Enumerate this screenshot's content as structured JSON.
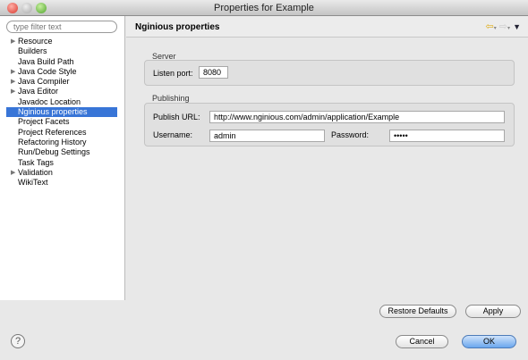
{
  "window": {
    "title": "Properties for Example"
  },
  "sidebar": {
    "filter_placeholder": "type filter text",
    "items": [
      {
        "label": "Resource",
        "expandable": true
      },
      {
        "label": "Builders"
      },
      {
        "label": "Java Build Path"
      },
      {
        "label": "Java Code Style",
        "expandable": true
      },
      {
        "label": "Java Compiler",
        "expandable": true
      },
      {
        "label": "Java Editor",
        "expandable": true
      },
      {
        "label": "Javadoc Location"
      },
      {
        "label": "Nginious properties",
        "selected": true
      },
      {
        "label": "Project Facets"
      },
      {
        "label": "Project References"
      },
      {
        "label": "Refactoring History"
      },
      {
        "label": "Run/Debug Settings"
      },
      {
        "label": "Task Tags"
      },
      {
        "label": "Validation",
        "expandable": true
      },
      {
        "label": "WikiText"
      }
    ]
  },
  "header": {
    "title": "Nginious properties",
    "back_icon": "arrow-left-icon",
    "forward_icon": "arrow-right-icon",
    "menu_icon": "chevron-down-icon"
  },
  "server": {
    "label": "Server",
    "port_label": "Listen port:",
    "port_value": "8080"
  },
  "publishing": {
    "label": "Publishing",
    "url_label": "Publish URL:",
    "url_value": "http://www.nginious.com/admin/application/Example",
    "username_label": "Username:",
    "username_value": "admin",
    "password_label": "Password:",
    "password_value": "•••••"
  },
  "buttons": {
    "restore": "Restore Defaults",
    "apply": "Apply",
    "cancel": "Cancel",
    "ok": "OK",
    "help": "?"
  }
}
